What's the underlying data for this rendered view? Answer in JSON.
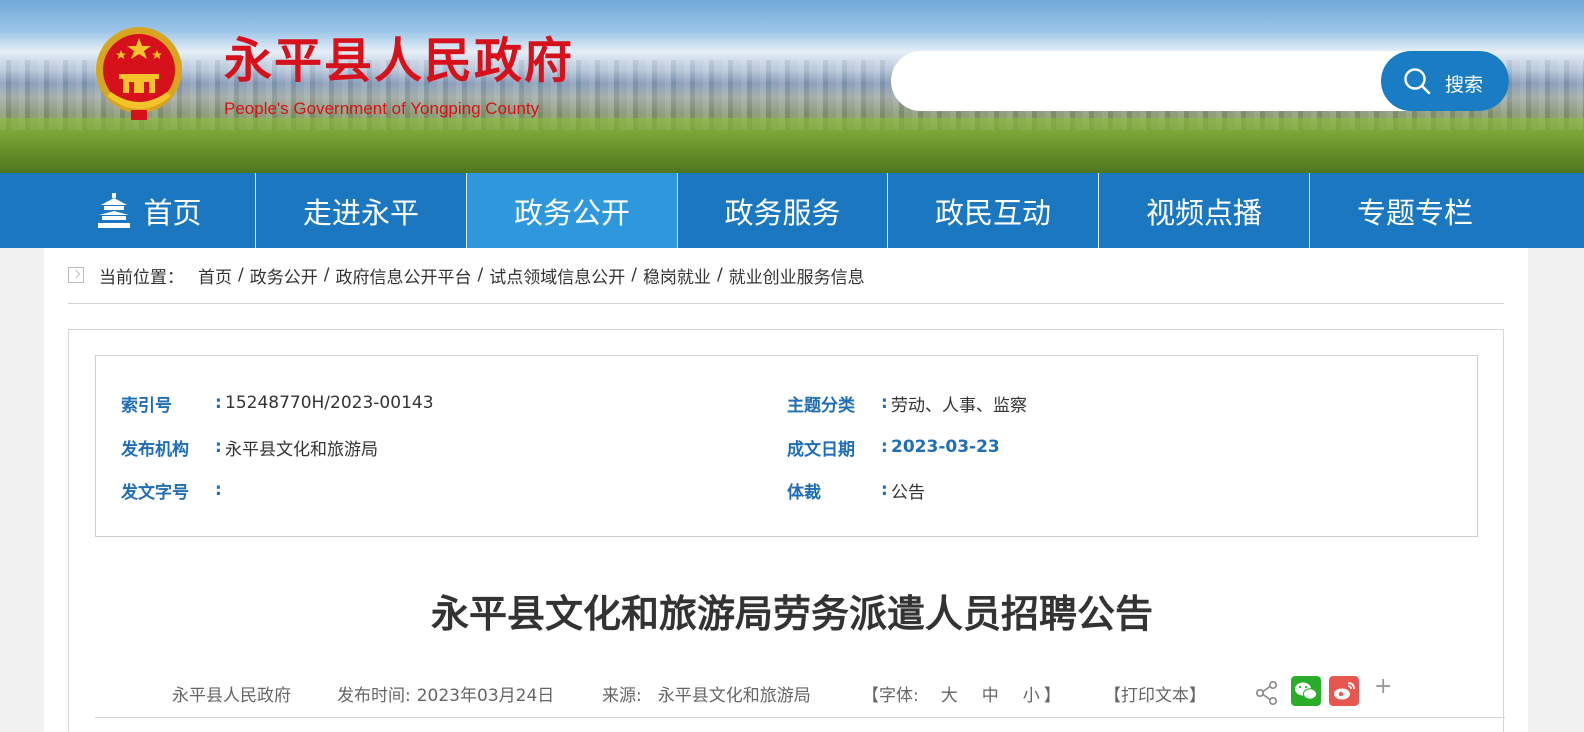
{
  "header": {
    "title": "永平县人民政府",
    "subtitle": "People's Government of Yongping County",
    "search": {
      "placeholder": "",
      "button_label": "搜索"
    }
  },
  "nav": {
    "items": [
      {
        "label": "首页",
        "icon": "home-tower-icon"
      },
      {
        "label": "走进永平"
      },
      {
        "label": "政务公开",
        "active": true
      },
      {
        "label": "政务服务"
      },
      {
        "label": "政民互动"
      },
      {
        "label": "视频点播"
      },
      {
        "label": "专题专栏"
      }
    ]
  },
  "breadcrumb": {
    "prefix": "当前位置：",
    "items": [
      "首页",
      "政务公开",
      "政府信息公开平台",
      "试点领域信息公开",
      "稳岗就业",
      "就业创业服务信息"
    ],
    "separator": "/"
  },
  "meta": {
    "index_no": {
      "key": "索引号",
      "value": "15248770H/2023-00143"
    },
    "topic": {
      "key": "主题分类",
      "value": "劳动、人事、监察"
    },
    "publisher": {
      "key": "发布机构",
      "value": "永平县文化和旅游局"
    },
    "date": {
      "key": "成文日期",
      "value": "2023-03-23"
    },
    "doc_no": {
      "key": "发文字号",
      "value": ""
    },
    "genre": {
      "key": "体裁",
      "value": "公告"
    },
    "colon": ":"
  },
  "article": {
    "title": "永平县文化和旅游局劳务派遣人员招聘公告",
    "site": "永平县人民政府",
    "publish_label": "发布时间:",
    "publish_date": "2023年03月24日",
    "source_label": "来源:",
    "source": "永平县文化和旅游局",
    "font_open": "【字体:",
    "font_large": "大",
    "font_medium": "中",
    "font_small": "小",
    "font_close": "】",
    "print": "【打印文本】",
    "plus": "+"
  },
  "colors": {
    "nav": "#1a77c0",
    "nav_active": "#2f97dc",
    "title_red": "#d6111b",
    "meta_blue": "#1f6eb7",
    "wechat": "#2aae2a",
    "weibo": "#e8574f"
  }
}
